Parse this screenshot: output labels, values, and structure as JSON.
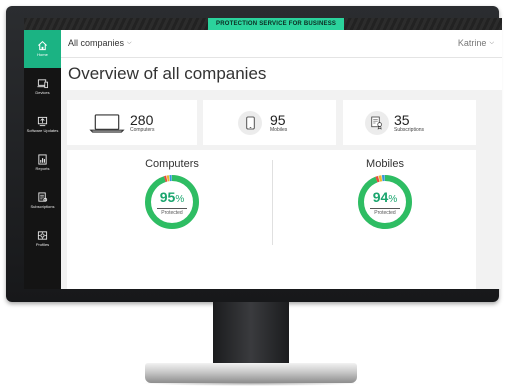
{
  "banner": {
    "label": "PROTECTION SERVICE FOR BUSINESS"
  },
  "sidebar": {
    "items": [
      {
        "label": "Home",
        "icon": "home-icon"
      },
      {
        "label": "Devices",
        "icon": "devices-icon"
      },
      {
        "label": "Software Updates",
        "icon": "software-updates-icon"
      },
      {
        "label": "Reports",
        "icon": "reports-icon"
      },
      {
        "label": "Subscriptions",
        "icon": "subscriptions-icon"
      },
      {
        "label": "Profiles",
        "icon": "profiles-icon"
      }
    ]
  },
  "header": {
    "company_selector": "All companies",
    "user": "Katrine"
  },
  "page": {
    "title": "Overview of all companies"
  },
  "stats": [
    {
      "value": "280",
      "label": "Computers",
      "icon": "laptop-icon"
    },
    {
      "value": "95",
      "label": "Mobiles",
      "icon": "mobile-icon"
    },
    {
      "value": "35",
      "label": "Subscriptions",
      "icon": "certificate-icon"
    }
  ],
  "gauges": [
    {
      "title": "Computers",
      "percent": "95",
      "percent_value": 95,
      "sign": "%",
      "label": "Protected"
    },
    {
      "title": "Mobiles",
      "percent": "94",
      "percent_value": 94,
      "sign": "%",
      "label": "Protected"
    }
  ],
  "colors": {
    "accent": "#1bb383",
    "protected": "#2ebd63",
    "banner": "#2bd39c",
    "warning": "#f0b429",
    "error": "#e74c3c",
    "info": "#3498db"
  }
}
